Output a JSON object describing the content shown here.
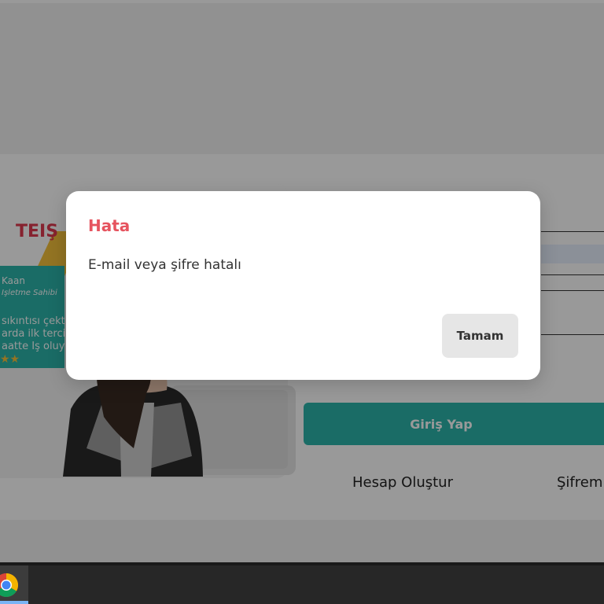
{
  "promo": {
    "brand": "TEIŞ",
    "testimonial_name": "Kaan",
    "testimonial_role": "İşletme Sahibi",
    "testimonial_lines": [
      "sıkıntısı çekti",
      "arda ilk tercih",
      "aatte İş oluyo"
    ],
    "stars": "★★"
  },
  "login": {
    "submit_label": "Giriş Yap",
    "create_account": "Hesap Oluştur",
    "forgot_password": "Şifremi"
  },
  "dialog": {
    "title": "Hata",
    "message": "E-mail veya şifre hatalı",
    "ok_label": "Tamam"
  },
  "taskbar": {
    "pinned_app": "chrome-icon"
  },
  "colors": {
    "brand_teal": "#2cb5ab",
    "brand_red": "#e0394f",
    "error_title": "#e6545f"
  }
}
